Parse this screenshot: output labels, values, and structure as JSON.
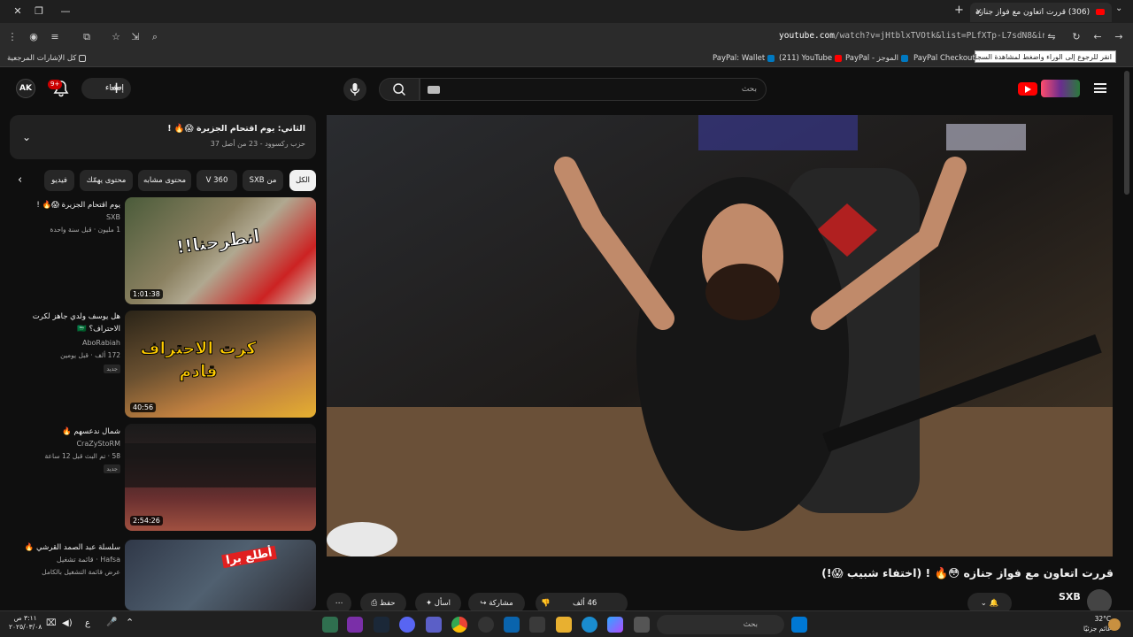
{
  "browser": {
    "tab_title": "(306) قررت اتعاون مع فواز جنازه",
    "url_host": "youtube.com",
    "url_rest": "/watch?v=jHtblxTVOtk&list=PLfXTp-L7sdN8&index=23",
    "tooltip": "انقر للرجوع إلى الوراء واضغط لمشاهدة السجل",
    "bookmarks": {
      "all_bookmarks": "كل الإشارات المرجعية",
      "paypal_checkout": "PayPal Checkout",
      "paypal_summary": "PayPal - الموجز",
      "youtube": "(211) YouTube",
      "paypal_wallet": "PayPal: Wallet"
    }
  },
  "header": {
    "avatar_text": "AK",
    "notif_badge": "9+",
    "create_label": "إنشاء",
    "search_placeholder": "بحث"
  },
  "playlist": {
    "title": "الثاني: يوم اقتحام الجزيرة 😱🔥 !",
    "subtitle": "حزب ركسوود - 23 من أصل 37"
  },
  "chips": [
    "الكل",
    "من SXB",
    "360 V",
    "محتوى مشابه",
    "محتوى يهمّك",
    "فيديو"
  ],
  "recommendations": [
    {
      "title": "يوم اقتحام الجزيرة 😱🔥 !",
      "channel": "SXB",
      "meta": "1 مليون · قبل سنة واحدة",
      "duration": "1:01:38",
      "badge": ""
    },
    {
      "title": "هل يوسف ولدي جاهز لكرت الاحتراف؟ 🇸🇦",
      "channel": "AboRabiah",
      "meta": "172 ألف · قبل يومين",
      "duration": "40:56",
      "badge": "جديد"
    },
    {
      "title": "شمال ندعسهم 🔥",
      "channel": "CraZyStoRM",
      "meta": "58 · تم البث قبل 12 ساعة",
      "duration": "2:54:26",
      "badge": "جديد"
    },
    {
      "title": "سلسلة عبد الصمد القرشي 🔥",
      "channel": "Hafsa · قائمة تشغيل",
      "meta": "عرض قائمة التشغيل بالكامل",
      "duration": "",
      "badge": ""
    }
  ],
  "thumb_text": {
    "t1": "انطرحنا!!",
    "t2": "كرت الاحتراف قادم",
    "t4": "أطلع برا"
  },
  "video": {
    "title": "قررت اتعاون مع فواز جنازه 😳🔥 ! (اختفاء شبيب 😱!)",
    "channel": "SXB",
    "likes": "46 ألف",
    "share": "مشاركة",
    "ask": "اسأل",
    "save": "حفظ"
  },
  "taskbar": {
    "time": "٣:١١ ص",
    "date": "٢٠٢٥/٠٣/٠٨",
    "lang": "ع",
    "search": "بحث",
    "temp": "32°C",
    "weather": "غائم جزئيًا"
  }
}
